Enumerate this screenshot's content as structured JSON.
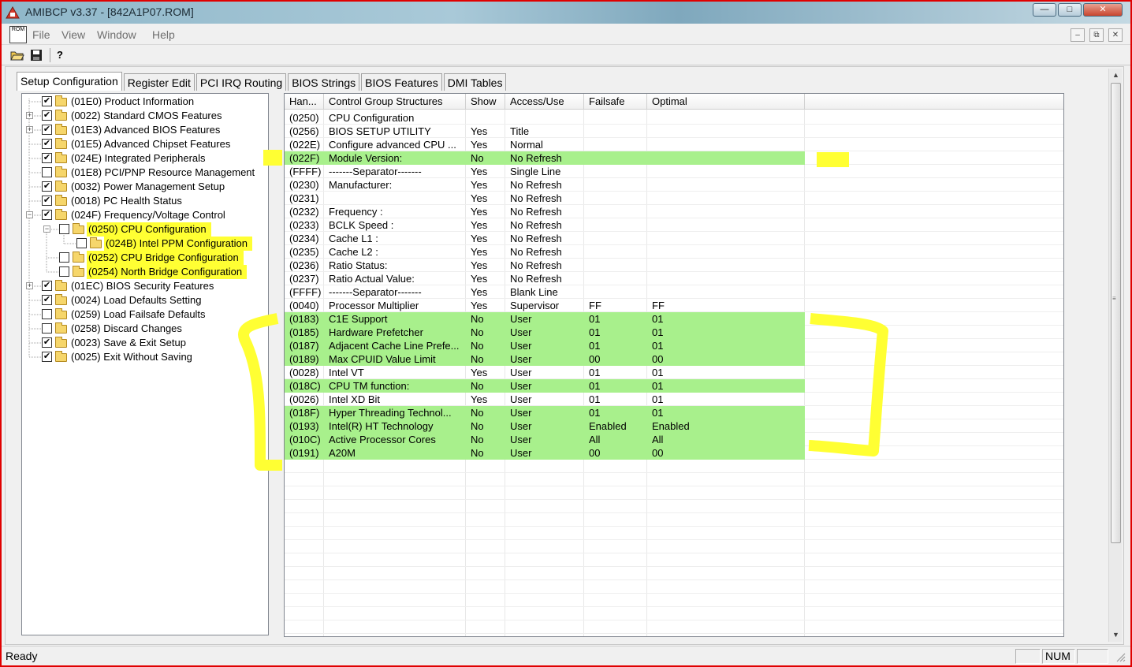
{
  "window": {
    "title": "AMIBCP v3.37 - [842A1P07.ROM]",
    "min_glyph": "—",
    "max_glyph": "□",
    "close_glyph": "✕"
  },
  "menu": {
    "doc_icon_text": "ROM",
    "items": [
      "File",
      "View",
      "Window",
      "Help"
    ],
    "mdi_min": "–",
    "mdi_restore": "⧉",
    "mdi_close": "✕"
  },
  "toolbar": {
    "open_icon": "📂",
    "save_icon": "💾",
    "help_icon": "?"
  },
  "tabs": [
    "Setup Configuration",
    "Register Edit",
    "PCI IRQ Routing",
    "BIOS Strings",
    "BIOS Features",
    "DMI Tables"
  ],
  "tree": [
    {
      "label": "(01E0) Product Information",
      "checked": true,
      "expander": "",
      "indent": 0
    },
    {
      "label": "(0022) Standard CMOS Features",
      "checked": true,
      "expander": "+",
      "indent": 0
    },
    {
      "label": "(01E3) Advanced BIOS Features",
      "checked": true,
      "expander": "+",
      "indent": 0
    },
    {
      "label": "(01E5) Advanced Chipset Features",
      "checked": true,
      "expander": "",
      "indent": 0
    },
    {
      "label": "(024E) Integrated Peripherals",
      "checked": true,
      "expander": "",
      "indent": 0
    },
    {
      "label": "(01E8) PCI/PNP Resource Management",
      "checked": false,
      "expander": "",
      "indent": 0
    },
    {
      "label": "(0032) Power Management Setup",
      "checked": true,
      "expander": "",
      "indent": 0
    },
    {
      "label": "(0018) PC Health Status",
      "checked": true,
      "expander": "",
      "indent": 0
    },
    {
      "label": "(024F) Frequency/Voltage Control",
      "checked": true,
      "expander": "−",
      "indent": 0
    },
    {
      "label": "(0250) CPU Configuration",
      "checked": false,
      "expander": "−",
      "indent": 1,
      "highlight": true
    },
    {
      "label": "(024B) Intel PPM Configuration",
      "checked": false,
      "expander": "",
      "indent": 2,
      "highlight": true
    },
    {
      "label": "(0252) CPU Bridge Configuration",
      "checked": false,
      "expander": "",
      "indent": 1,
      "highlight": true
    },
    {
      "label": "(0254) North Bridge Configuration",
      "checked": false,
      "expander": "",
      "indent": 1,
      "highlight": true
    },
    {
      "label": "(01EC) BIOS Security Features",
      "checked": true,
      "expander": "+",
      "indent": 0
    },
    {
      "label": "(0024) Load Defaults Setting",
      "checked": true,
      "expander": "",
      "indent": 0
    },
    {
      "label": "(0259) Load Failsafe Defaults",
      "checked": false,
      "expander": "",
      "indent": 0
    },
    {
      "label": "(0258) Discard Changes",
      "checked": false,
      "expander": "",
      "indent": 0
    },
    {
      "label": "(0023) Save & Exit Setup",
      "checked": true,
      "expander": "",
      "indent": 0
    },
    {
      "label": "(0025) Exit Without Saving",
      "checked": true,
      "expander": "",
      "indent": 0
    }
  ],
  "check_glyph": "✔",
  "table": {
    "headers": [
      "Han...",
      "Control Group Structures",
      "Show",
      "Access/Use",
      "Failsafe",
      "Optimal"
    ],
    "rows": [
      {
        "h": "(0250)",
        "name": "CPU Configuration",
        "show": "",
        "access": "",
        "failsafe": "",
        "optimal": "",
        "green": false
      },
      {
        "h": "(0256)",
        "name": "BIOS SETUP UTILITY",
        "show": "Yes",
        "access": "Title",
        "failsafe": "",
        "optimal": "",
        "green": false
      },
      {
        "h": "(022E)",
        "name": "Configure advanced CPU ...",
        "show": "Yes",
        "access": "Normal",
        "failsafe": "",
        "optimal": "",
        "green": false
      },
      {
        "h": "(022F)",
        "name": "Module Version:",
        "show": "No",
        "access": "No Refresh",
        "failsafe": "",
        "optimal": "",
        "green": true
      },
      {
        "h": "(FFFF)",
        "name": "-------Separator-------",
        "show": "Yes",
        "access": "Single Line",
        "failsafe": "",
        "optimal": "",
        "green": false
      },
      {
        "h": "(0230)",
        "name": "Manufacturer:",
        "show": "Yes",
        "access": "No Refresh",
        "failsafe": "",
        "optimal": "",
        "green": false
      },
      {
        "h": "(0231)",
        "name": "",
        "show": "Yes",
        "access": "No Refresh",
        "failsafe": "",
        "optimal": "",
        "green": false
      },
      {
        "h": "(0232)",
        "name": "Frequency    :",
        "show": "Yes",
        "access": "No Refresh",
        "failsafe": "",
        "optimal": "",
        "green": false
      },
      {
        "h": "(0233)",
        "name": "BCLK Speed  :",
        "show": "Yes",
        "access": "No Refresh",
        "failsafe": "",
        "optimal": "",
        "green": false
      },
      {
        "h": "(0234)",
        "name": "Cache L1     :",
        "show": "Yes",
        "access": "No Refresh",
        "failsafe": "",
        "optimal": "",
        "green": false
      },
      {
        "h": "(0235)",
        "name": "Cache L2     :",
        "show": "Yes",
        "access": "No Refresh",
        "failsafe": "",
        "optimal": "",
        "green": false
      },
      {
        "h": "(0236)",
        "name": "Ratio Status:",
        "show": "Yes",
        "access": "No Refresh",
        "failsafe": "",
        "optimal": "",
        "green": false
      },
      {
        "h": "(0237)",
        "name": "Ratio Actual Value:",
        "show": "Yes",
        "access": "No Refresh",
        "failsafe": "",
        "optimal": "",
        "green": false
      },
      {
        "h": "(FFFF)",
        "name": "-------Separator-------",
        "show": "Yes",
        "access": "Blank Line",
        "failsafe": "",
        "optimal": "",
        "green": false
      },
      {
        "h": "(0040)",
        "name": "Processor Multiplier",
        "show": "Yes",
        "access": "Supervisor",
        "failsafe": "FF",
        "optimal": "FF",
        "green": false
      },
      {
        "h": "(0183)",
        "name": "C1E Support",
        "show": "No",
        "access": "User",
        "failsafe": "01",
        "optimal": "01",
        "green": true
      },
      {
        "h": "(0185)",
        "name": "Hardware Prefetcher",
        "show": "No",
        "access": "User",
        "failsafe": "01",
        "optimal": "01",
        "green": true
      },
      {
        "h": "(0187)",
        "name": "Adjacent Cache Line Prefe...",
        "show": "No",
        "access": "User",
        "failsafe": "01",
        "optimal": "01",
        "green": true
      },
      {
        "h": "(0189)",
        "name": "Max CPUID Value Limit",
        "show": "No",
        "access": "User",
        "failsafe": "00",
        "optimal": "00",
        "green": true
      },
      {
        "h": "(0028)",
        "name": "Intel VT",
        "show": "Yes",
        "access": "User",
        "failsafe": "01",
        "optimal": "01",
        "green": false
      },
      {
        "h": "(018C)",
        "name": "CPU TM function:",
        "show": "No",
        "access": "User",
        "failsafe": "01",
        "optimal": "01",
        "green": true
      },
      {
        "h": "(0026)",
        "name": "Intel XD Bit",
        "show": "Yes",
        "access": "User",
        "failsafe": "01",
        "optimal": "01",
        "green": false
      },
      {
        "h": "(018F)",
        "name": "Hyper Threading Technol...",
        "show": "No",
        "access": "User",
        "failsafe": "01",
        "optimal": "01",
        "green": true
      },
      {
        "h": "(0193)",
        "name": "Intel(R) HT Technology",
        "show": "No",
        "access": "User",
        "failsafe": "Enabled",
        "optimal": "Enabled",
        "green": true
      },
      {
        "h": "(010C)",
        "name": "Active Processor Cores",
        "show": "No",
        "access": "User",
        "failsafe": "All",
        "optimal": "All",
        "green": true
      },
      {
        "h": "(0191)",
        "name": "A20M",
        "show": "No",
        "access": "User",
        "failsafe": "00",
        "optimal": "00",
        "green": true
      }
    ]
  },
  "scroll": {
    "up": "▲",
    "down": "▼",
    "grip": "≡"
  },
  "status": {
    "text": "Ready",
    "num": "NUM"
  },
  "colors": {
    "green_row": "#a8f08c",
    "highlight": "#ffff33",
    "frame": "#e00000"
  }
}
